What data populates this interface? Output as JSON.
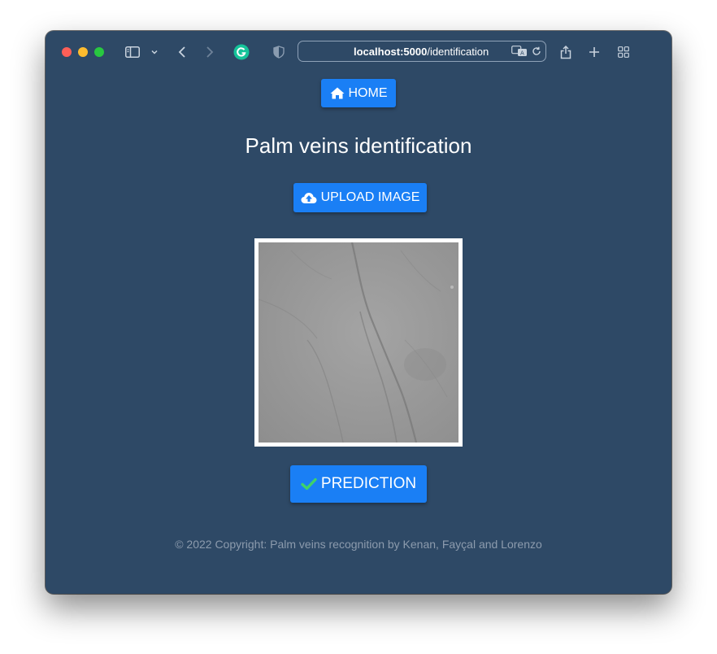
{
  "browser": {
    "url_host": "localhost:5000",
    "url_path": "/identification"
  },
  "colors": {
    "page_background": "#2e4966",
    "button": "#1a7ff5",
    "check": "#3fd26a"
  },
  "nav": {
    "home_label": "HOME",
    "home_icon": "home-icon"
  },
  "page": {
    "title": "Palm veins identification",
    "upload_label": "UPLOAD IMAGE",
    "upload_icon": "cloud-upload-icon",
    "prediction_label": "PREDICTION",
    "prediction_icon": "check-icon"
  },
  "footer": {
    "text": "© 2022 Copyright: Palm veins recognition by Kenan, Fayçal and Lorenzo"
  }
}
